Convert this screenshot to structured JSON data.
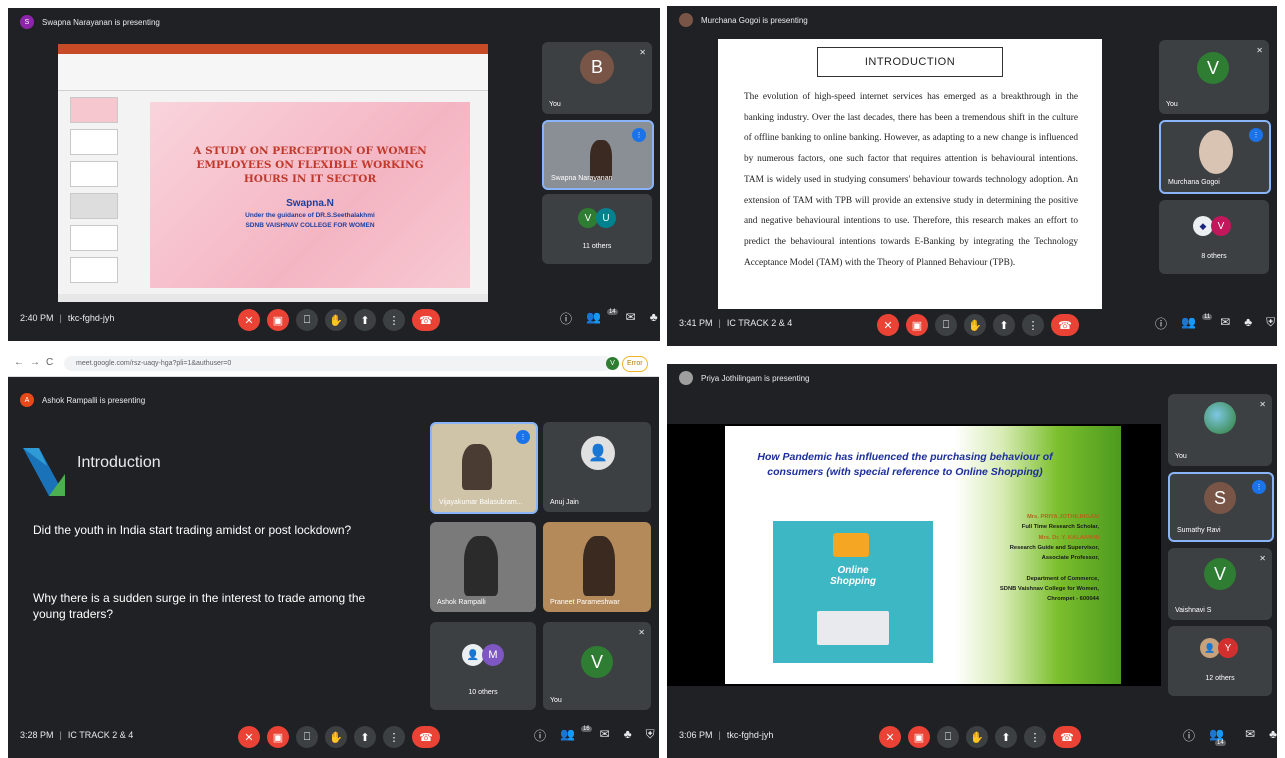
{
  "q1": {
    "presenter": {
      "initial": "S",
      "text": "Swapna Narayanan is presenting",
      "color": "#8e24aa"
    },
    "slide": {
      "title": "A STUDY ON PERCEPTION OF WOMEN EMPLOYEES ON FLEXIBLE WORKING HOURS IN IT SECTOR",
      "author": "Swapna.N",
      "guidance": "Under the guidance of DR.S.Seethalakhmi",
      "college": "SDNB VAISHNAV COLLEGE FOR WOMEN"
    },
    "tiles": [
      {
        "label": "You",
        "initial": "B",
        "color": "#795548"
      },
      {
        "label": "Swapna Narayanan"
      },
      {
        "label": "11 others",
        "initials": [
          "V",
          "U"
        ],
        "colors": [
          "#2e7d32",
          "#00838f"
        ]
      }
    ],
    "time": "2:40 PM",
    "code": "tkc-fghd-jyh",
    "people_count": "14"
  },
  "q2": {
    "presenter": {
      "text": "Murchana Gogoi is presenting"
    },
    "slide": {
      "title": "INTRODUCTION",
      "body": "The evolution of high-speed internet services has emerged as a breakthrough in the banking industry. Over the last decades, there has been a tremendous shift in the culture of offline banking to online banking. However, as adapting to a new change is influenced by numerous factors, one such factor that requires attention is behavioural intentions. TAM is widely used in studying consumers' behaviour towards technology adoption. An extension of TAM with TPB will provide an extensive study in determining the positive and negative behavioural intentions to use. Therefore, this research makes an effort to predict the behavioural intentions towards E-Banking by integrating the Technology Acceptance Model (TAM) with the Theory of Planned Behaviour (TPB)."
    },
    "tiles": [
      {
        "label": "You",
        "initial": "V",
        "color": "#2e7d32"
      },
      {
        "label": "Murchana Gogoi"
      },
      {
        "label": "8 others",
        "initial": "V",
        "color": "#c2185b"
      }
    ],
    "time": "3:41 PM",
    "code": "IC TRACK 2 & 4",
    "people_count": "11"
  },
  "q3": {
    "url": "meet.google.com/rsz-uaqy-hga?pli=1&authuser=0",
    "extension_label": "Error",
    "profile_initial": "V",
    "presenter": {
      "initial": "A",
      "text": "Ashok Rampalli is presenting",
      "color": "#e64a19"
    },
    "slide": {
      "title": "Introduction",
      "q1": "Did the youth in India start trading amidst or post lockdown?",
      "q2": "Why there is a sudden surge in the interest to trade among the young traders?"
    },
    "tiles": [
      {
        "label": "Vijayakumar Balasubram..."
      },
      {
        "label": "Anuj Jain"
      },
      {
        "label": "Ashok Rampalli"
      },
      {
        "label": "Praneet Parameshwar"
      },
      {
        "label": "10 others",
        "initial": "M",
        "color": "#7e57c2"
      },
      {
        "label": "You",
        "initial": "V",
        "color": "#2e7d32"
      }
    ],
    "time": "3:28 PM",
    "code": "IC TRACK 2 & 4",
    "people_count": "16"
  },
  "q4": {
    "presenter": {
      "text": "Priya Jothilingam is presenting"
    },
    "slide": {
      "title": "How Pandemic has influenced the purchasing behaviour of consumers (with special reference to Online Shopping)",
      "lines": [
        {
          "text": "Mrs. PRIYA JOTHILINGAM",
          "accent": true
        },
        {
          "text": "Full Time Research Scholar,",
          "accent": false
        },
        {
          "text": "Mrs. Dr. Y. KALAIVANI",
          "accent": true
        },
        {
          "text": "Research Guide and Supervisor,",
          "accent": false
        },
        {
          "text": "Associate Professor,",
          "accent": false
        },
        {
          "text": "",
          "accent": false
        },
        {
          "text": "Department of Commerce,",
          "accent": false
        },
        {
          "text": "SDNB Vaishnav College for Women,",
          "accent": false
        },
        {
          "text": "Chrompet - 600044",
          "accent": false
        }
      ],
      "image_text": "Online Shopping"
    },
    "tiles": [
      {
        "label": "You"
      },
      {
        "label": "Sumathy Ravi",
        "initial": "S",
        "color": "#795548"
      },
      {
        "label": "Vaishnavi S",
        "initial": "V",
        "color": "#2e7d32"
      },
      {
        "label": "12 others",
        "initial": "Y",
        "color": "#d32f2f"
      }
    ],
    "time": "3:06 PM",
    "code": "tkc-fghd-jyh",
    "people_count": "14"
  },
  "colors": {
    "meet_bg": "#202124",
    "tile_bg": "#3c4043",
    "red": "#ea4335",
    "accent_blue": "#8ab4f8"
  }
}
